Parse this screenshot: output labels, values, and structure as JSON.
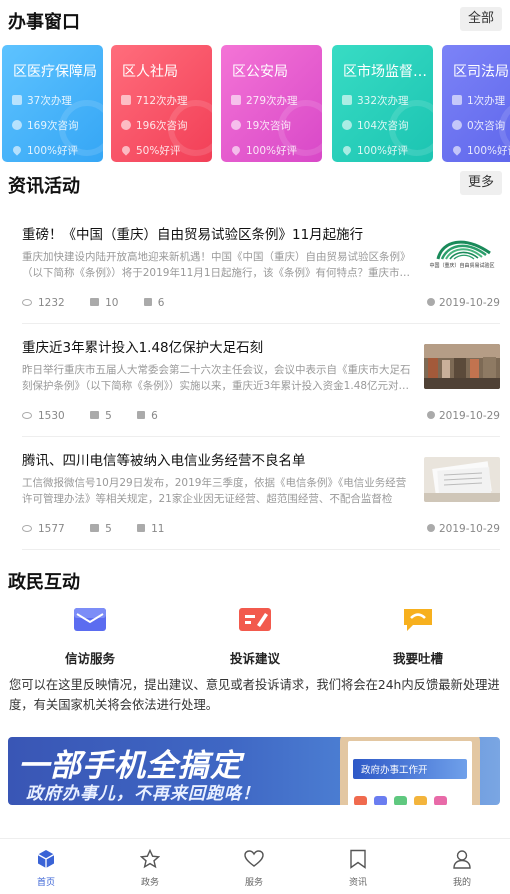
{
  "sections": {
    "windows": {
      "title": "办事窗口",
      "more": "全部"
    },
    "news": {
      "title": "资讯活动",
      "more": "更多"
    },
    "interaction": {
      "title": "政民互动"
    }
  },
  "offices": [
    {
      "name": "区医疗保障局",
      "handled": "37次办理",
      "consult": "169次咨询",
      "rating": "100%好评",
      "color_from": "#5ec3ff",
      "color_to": "#35a6f5"
    },
    {
      "name": "区人社局",
      "handled": "712次办理",
      "consult": "196次咨询",
      "rating": "50%好评",
      "color_from": "#ff6d7c",
      "color_to": "#f23f57"
    },
    {
      "name": "区公安局",
      "handled": "279次办理",
      "consult": "19次咨询",
      "rating": "100%好评",
      "color_from": "#f474d6",
      "color_to": "#d848c8"
    },
    {
      "name": "区市场监督管理局",
      "handled": "332次办理",
      "consult": "104次咨询",
      "rating": "100%好评",
      "color_from": "#38dcc4",
      "color_to": "#1cc4b2"
    },
    {
      "name": "区司法局",
      "handled": "1次办理",
      "consult": "0次咨询",
      "rating": "100%好评",
      "color_from": "#7c83f7",
      "color_to": "#5b63ea"
    }
  ],
  "news": [
    {
      "title": "重磅！《中国（重庆）自由贸易试验区条例》11月起施行",
      "desc": "重庆加快建设内陆开放高地迎来新机遇！中国《中国（重庆）自由贸易试验区条例》（以下简称《条例》）将于2019年11月1日起施行，该《条例》有何特点？重庆市…",
      "views": "1232",
      "comments": "10",
      "likes": "6",
      "date": "2019-10-29",
      "thumb_text": "中国（重庆）自由贸易试验区"
    },
    {
      "title": "重庆近3年累计投入1.48亿保护大足石刻",
      "desc": "昨日举行重庆市五届人大常委会第二十六次主任会议，会议中表示自《重庆市大足石刻保护条例》（以下简称《条例》）实施以来，重庆近3年累计投入资金1.48亿元对…",
      "views": "1530",
      "comments": "5",
      "likes": "6",
      "date": "2019-10-29"
    },
    {
      "title": "腾讯、四川电信等被纳入电信业务经营不良名单",
      "desc": "工信微报微信号10月29日发布，2019年三季度，依据《电信条例》《电信业务经营许可管理办法》等相关规定，21家企业因无证经营、超范围经营、不配合监督检查、…",
      "views": "1577",
      "comments": "5",
      "likes": "11",
      "date": "2019-10-29"
    }
  ],
  "interaction": {
    "items": [
      {
        "label": "信访服务",
        "icon": "envelope-icon",
        "color": "#5b6cf0"
      },
      {
        "label": "投诉建议",
        "icon": "edit-icon",
        "color": "#f25a4d"
      },
      {
        "label": "我要吐槽",
        "icon": "chat-icon",
        "color": "#f7b01e"
      }
    ],
    "desc": "您可以在这里反映情况，提出建议、意见或者投诉请求，我们将会在24h内反馈最新处理进度，有关国家机关将会依法进行处理。"
  },
  "banner": {
    "headline": "一部手机全搞定",
    "subline": "政府办事儿，不再来回跑咯！",
    "screen_text": "政府办事工作开"
  },
  "tabbar": [
    {
      "label": "首页",
      "icon": "home-cube-icon",
      "active": true
    },
    {
      "label": "政务",
      "icon": "star-icon",
      "active": false
    },
    {
      "label": "服务",
      "icon": "heart-icon",
      "active": false
    },
    {
      "label": "资讯",
      "icon": "bookmark-icon",
      "active": false
    },
    {
      "label": "我的",
      "icon": "user-icon",
      "active": false
    }
  ]
}
